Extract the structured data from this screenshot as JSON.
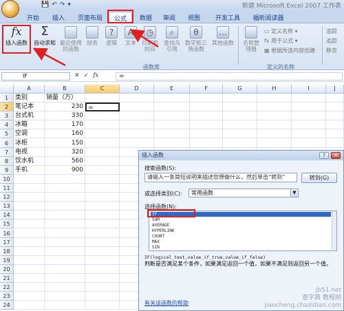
{
  "window": {
    "title": "新建 Microsoft Excel 2007 工作表",
    "qat_items": [
      "💾",
      "↶",
      "↷",
      "▾"
    ]
  },
  "tabs": [
    "开始",
    "插入",
    "页面布局",
    "公式",
    "数据",
    "审阅",
    "视图",
    "开发工具",
    "福昕阅读器"
  ],
  "active_tab": "公式",
  "ribbon": {
    "insert_function": {
      "icon": "fx",
      "label": "插入函数"
    },
    "autosum": {
      "icon": "Σ",
      "label": "自动求和"
    },
    "recent": {
      "label": "最近使用的函数"
    },
    "finance": {
      "label": "财务"
    },
    "logical": {
      "label": "逻辑"
    },
    "text": {
      "label": "文本"
    },
    "datetime": {
      "label": "日期和时间"
    },
    "lookup": {
      "label": "查找与引用"
    },
    "math": {
      "label": "数学和三角函数"
    },
    "other": {
      "label": "其他函数"
    },
    "name_manager": {
      "label": "名称管理器"
    },
    "define_name": "定义名称",
    "use_in_formula": "用于公式",
    "create_from_selection": "根据所选内容创建",
    "library_group": "函数库",
    "names_group": "定义的名称",
    "right_items": [
      "追踪",
      "追踪",
      "移去"
    ]
  },
  "formula_bar": {
    "name_box": "IF",
    "icons": [
      "✕",
      "✓",
      "fx"
    ],
    "content": "="
  },
  "grid": {
    "columns": [
      "A",
      "B",
      "C",
      "D",
      "E",
      "F",
      "G",
      "H",
      "I",
      "J"
    ],
    "rows": [
      "1",
      "2",
      "3",
      "4",
      "5",
      "6",
      "7",
      "8",
      "9",
      "10",
      "11",
      "12",
      "13",
      "14",
      "15",
      "16",
      "17",
      "18",
      "19",
      "20",
      "21",
      "22",
      "23",
      "24"
    ],
    "header_a": "类别",
    "header_b": "销量（万）",
    "data": [
      {
        "name": "笔记本",
        "value": "230"
      },
      {
        "name": "台式机",
        "value": "330"
      },
      {
        "name": "冰箱",
        "value": "170"
      },
      {
        "name": "空调",
        "value": "160"
      },
      {
        "name": "冰柜",
        "value": "150"
      },
      {
        "name": "电视",
        "value": "320"
      },
      {
        "name": "饮水机",
        "value": "560"
      },
      {
        "name": "手机",
        "value": "900"
      }
    ],
    "active_cell_value": "="
  },
  "dialog": {
    "title": "插入函数",
    "help_button": "?",
    "close_button": "✕",
    "search_label": "搜索函数(S):",
    "search_value": "请输入一条简短说明来描述您想做什么，然后单击“转到”",
    "go_button": "转到(G)",
    "category_label": "或选择类别(C):",
    "category_value": "常用函数",
    "select_label": "选择函数(N):",
    "functions": [
      "IF",
      "SUM",
      "AVERAGE",
      "HYPERLINK",
      "COUNT",
      "MAX",
      "SIN"
    ],
    "selected_function": "IF",
    "signature": "IF(logical_test,value_if_true,value_if_false)",
    "description": "判断是否满足某个条件，如果满足返回一个值，如果不满足则返回另一个值。",
    "help_link": "有关该函数的帮助"
  },
  "watermark": [
    "jb51.net",
    "查字典 教程网",
    "jiaocheng.chazidian.com"
  ]
}
